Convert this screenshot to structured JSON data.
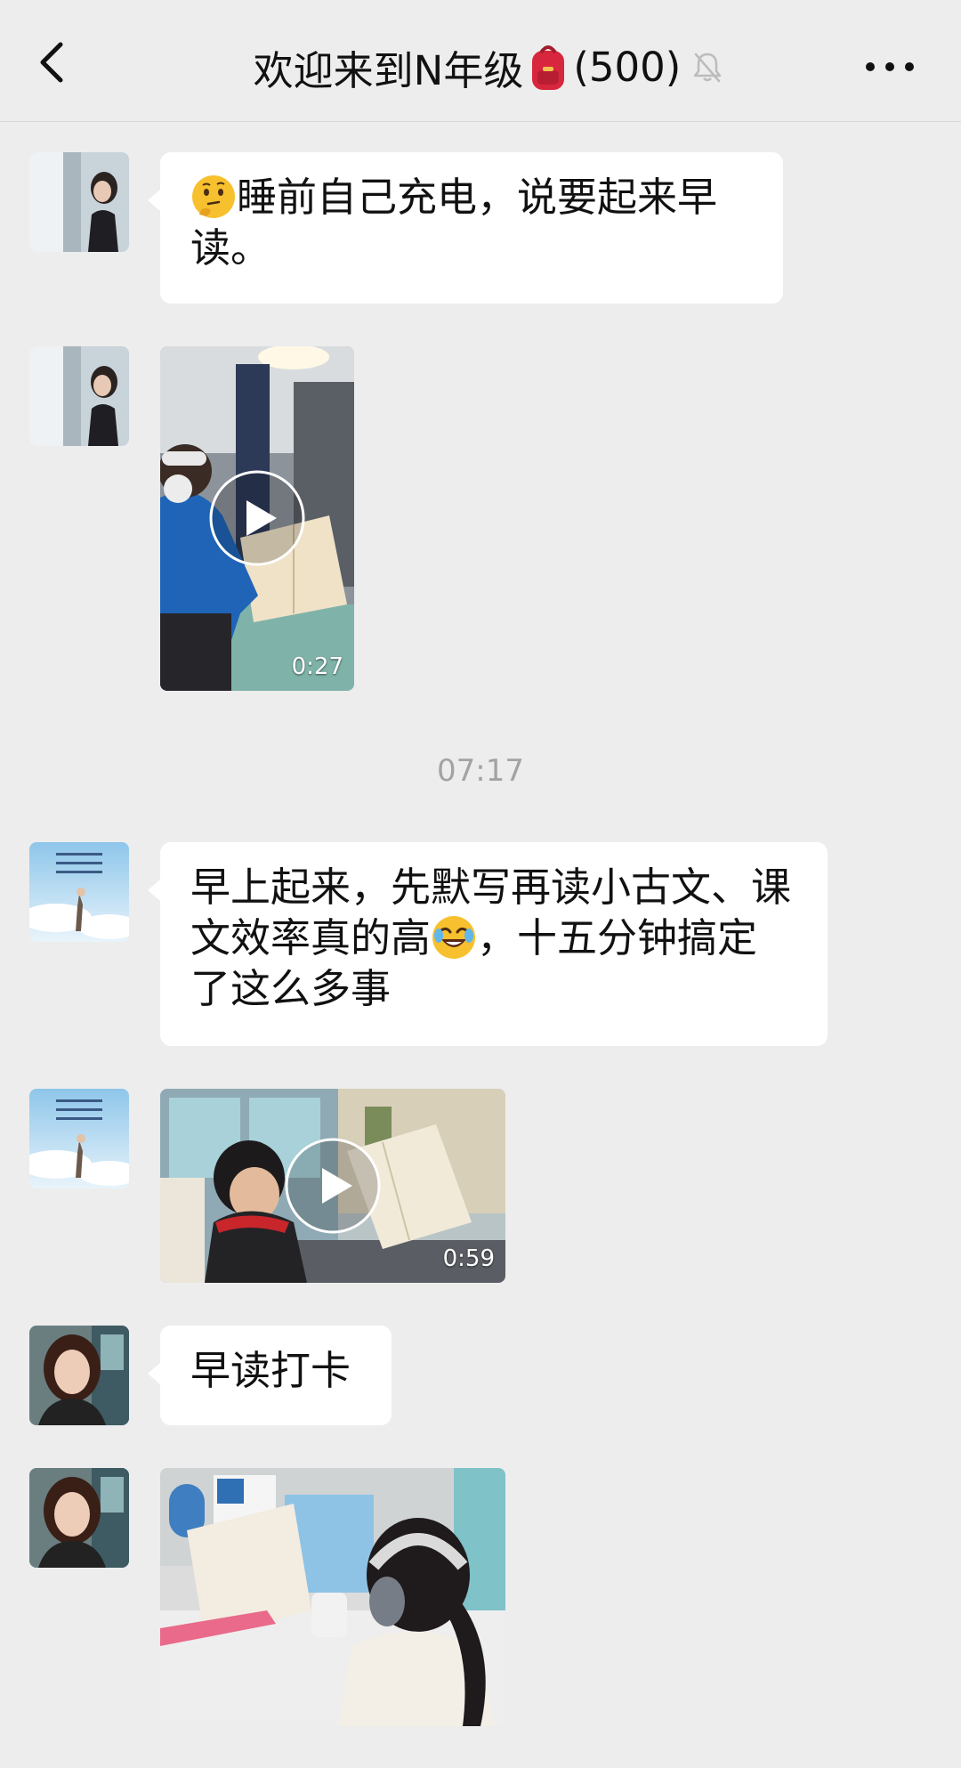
{
  "header": {
    "title": "欢迎来到N年级",
    "member_count": "(500)"
  },
  "messages": [
    {
      "type": "text",
      "text": "睡前自己充电，说要起来早读。",
      "emoji": "thinking-face-icon"
    },
    {
      "type": "video",
      "duration": "0:27"
    },
    {
      "type": "timestamp",
      "text": "07:17"
    },
    {
      "type": "text",
      "text_before": "早上起来，先默写再读小古文、课文效率真的高",
      "text_after": "，十五分钟搞定了这么多事",
      "emoji": "rolling-laughing-icon"
    },
    {
      "type": "video",
      "duration": "0:59"
    },
    {
      "type": "text",
      "text": "早读打卡"
    },
    {
      "type": "image"
    }
  ],
  "colors": {
    "background": "#ededed",
    "bubble": "#ffffff",
    "timestamp": "#a3a3a3"
  }
}
